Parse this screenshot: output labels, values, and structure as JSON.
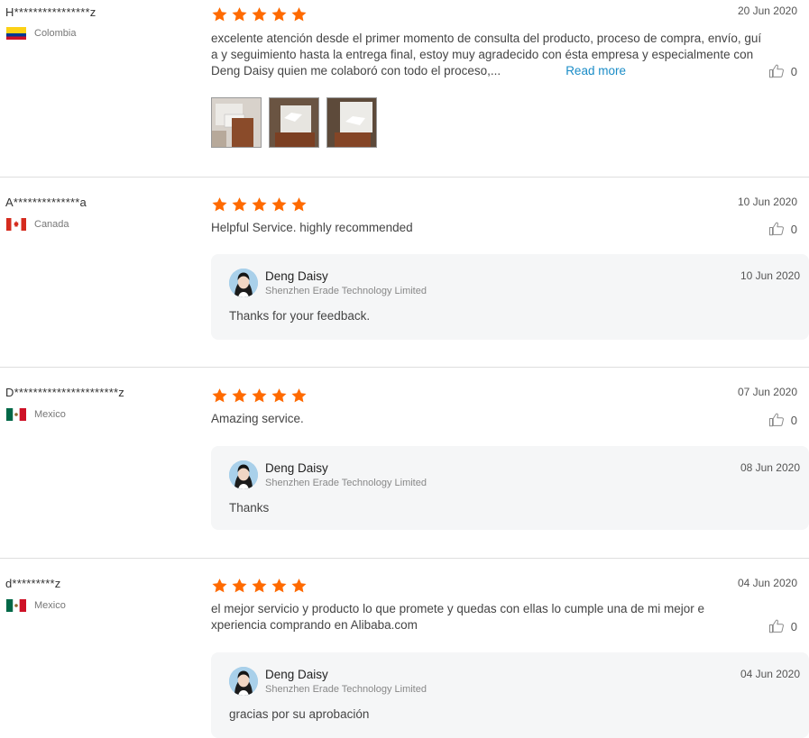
{
  "colors": {
    "star": "#ff6a00",
    "link": "#1a8cc7",
    "reply_bg": "#f5f6f7"
  },
  "reviews": [
    {
      "buyer": "H****************z",
      "country": "Colombia",
      "flag": "colombia-flag",
      "rating": 5,
      "date": "20 Jun 2020",
      "content_lines": [
        "excelente atención desde el primer momento de consulta del producto, proceso de compra, envío, guí",
        "a y seguimiento hasta la entrega final, estoy muy agradecido con ésta empresa y especialmente con",
        "Deng Daisy quien me colaboró con todo el proceso,..."
      ],
      "read_more": "Read more",
      "likes": "0",
      "photo_count": 3
    },
    {
      "buyer": "A**************a",
      "country": "Canada",
      "flag": "canada-flag",
      "rating": 5,
      "date": "10 Jun 2020",
      "content": "Helpful Service. highly recommended",
      "likes": "0",
      "reply": {
        "name": "Deng Daisy",
        "company": "Shenzhen Erade Technology Limited",
        "date": "10 Jun 2020",
        "text": "Thanks for your feedback."
      }
    },
    {
      "buyer": "D**********************z",
      "country": "Mexico",
      "flag": "mexico-flag",
      "rating": 5,
      "date": "07 Jun 2020",
      "content": "Amazing service.",
      "likes": "0",
      "reply": {
        "name": "Deng Daisy",
        "company": "Shenzhen Erade Technology Limited",
        "date": "08 Jun 2020",
        "text": "Thanks"
      }
    },
    {
      "buyer": "d*********z",
      "country": "Mexico",
      "flag": "mexico-flag",
      "rating": 5,
      "date": "04 Jun 2020",
      "content_lines": [
        "el mejor servicio y producto lo que promete y quedas con ellas lo cumple una de mi mejor e",
        "xperiencia comprando en Alibaba.com"
      ],
      "likes": "0",
      "reply": {
        "name": "Deng Daisy",
        "company": "Shenzhen Erade Technology Limited",
        "date": "04 Jun 2020",
        "text": "gracias por su aprobación"
      }
    }
  ]
}
